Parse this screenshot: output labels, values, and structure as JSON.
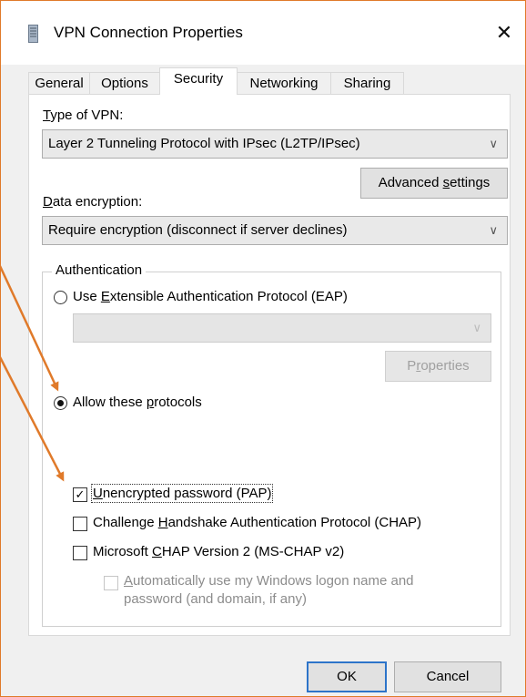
{
  "window": {
    "title": "VPN Connection Properties",
    "close_glyph": "✕"
  },
  "tabs": [
    {
      "label": "General"
    },
    {
      "label": "Options"
    },
    {
      "label": "Security"
    },
    {
      "label": "Networking"
    },
    {
      "label": "Sharing"
    }
  ],
  "security": {
    "vpn_type_label_u": "T",
    "vpn_type_label_rest": "ype of VPN:",
    "vpn_type_value": "Layer 2 Tunneling Protocol with IPsec (L2TP/IPsec)",
    "advanced_label_pre": "Advanced ",
    "advanced_label_u": "s",
    "advanced_label_post": "ettings",
    "encryption_label_u": "D",
    "encryption_label_rest": "ata encryption:",
    "encryption_value": "Require encryption (disconnect if server declines)",
    "auth_group_title": "Authentication",
    "eap_label_pre": "Use ",
    "eap_label_u": "E",
    "eap_label_post": "xtensible Authentication Protocol (EAP)",
    "eap_select_value": "",
    "properties_pre": "P",
    "properties_u": "r",
    "properties_post": "operties",
    "allow_label_pre": "Allow these ",
    "allow_label_u": "p",
    "allow_label_post": "rotocols",
    "pap_u": "U",
    "pap_rest": "nencrypted password (PAP)",
    "chap_pre": "Challenge ",
    "chap_u": "H",
    "chap_post": "andshake Authentication Protocol (CHAP)",
    "mschap_pre": "Microsoft ",
    "mschap_u": "C",
    "mschap_post": "HAP Version 2 (MS-CHAP v2)",
    "autologon_u": "A",
    "autologon_rest": "utomatically use my Windows logon name and",
    "autologon_line2": "password (and domain, if any)"
  },
  "state": {
    "selected_tab": "Security",
    "eap_selected": false,
    "allow_selected": true,
    "pap_checked": true,
    "chap_checked": false,
    "mschap_checked": false,
    "autologon_checked": false
  },
  "footer": {
    "ok_label": "OK",
    "cancel_label": "Cancel"
  },
  "icons": {
    "chevron": "∨",
    "check": "✓"
  },
  "colors": {
    "annotation_arrow": "#e07a2a",
    "focus_border": "#2d74c9"
  }
}
